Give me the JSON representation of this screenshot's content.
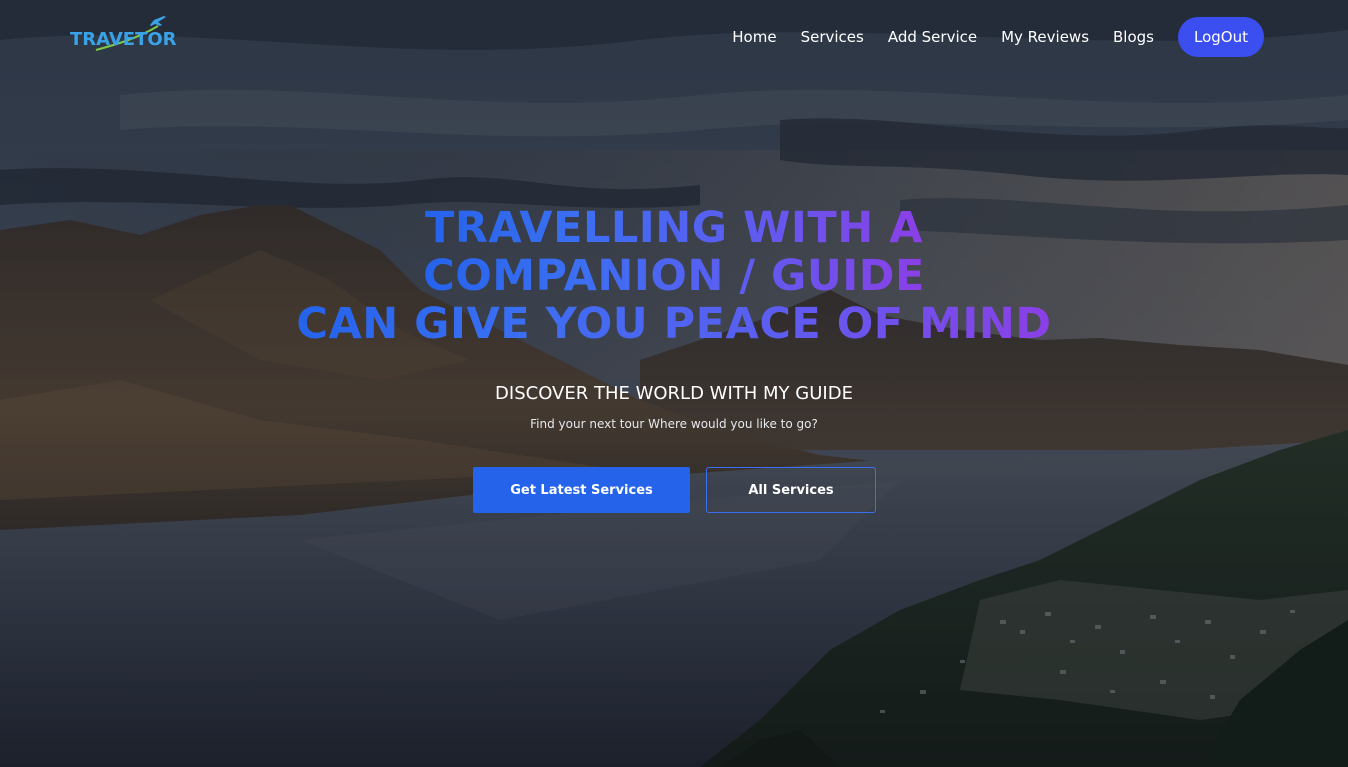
{
  "brand": {
    "logo_text": "TRAVETOR",
    "logo_color": "#3aa3e8",
    "logo_accent": "#7ec84a"
  },
  "nav": {
    "items": [
      {
        "label": "Home"
      },
      {
        "label": "Services"
      },
      {
        "label": "Add Service"
      },
      {
        "label": "My Reviews"
      },
      {
        "label": "Blogs"
      }
    ],
    "logout_label": "LogOut"
  },
  "hero": {
    "headline_lines": [
      "TRAVELLING WITH A",
      "COMPANION / GUIDE",
      "CAN GIVE YOU PEACE OF MIND"
    ],
    "subtitle": "DISCOVER THE WORLD WITH MY GUIDE",
    "tagline": "Find your next tour Where would you like to go?",
    "primary_button": "Get Latest Services",
    "secondary_button": "All Services",
    "background": "mountain-lake-landscape"
  },
  "colors": {
    "accent": "#3b4ef0",
    "primary_button": "#2563eb",
    "headline_gradient_start": "#2563eb",
    "headline_gradient_end": "#8b3fe6"
  }
}
